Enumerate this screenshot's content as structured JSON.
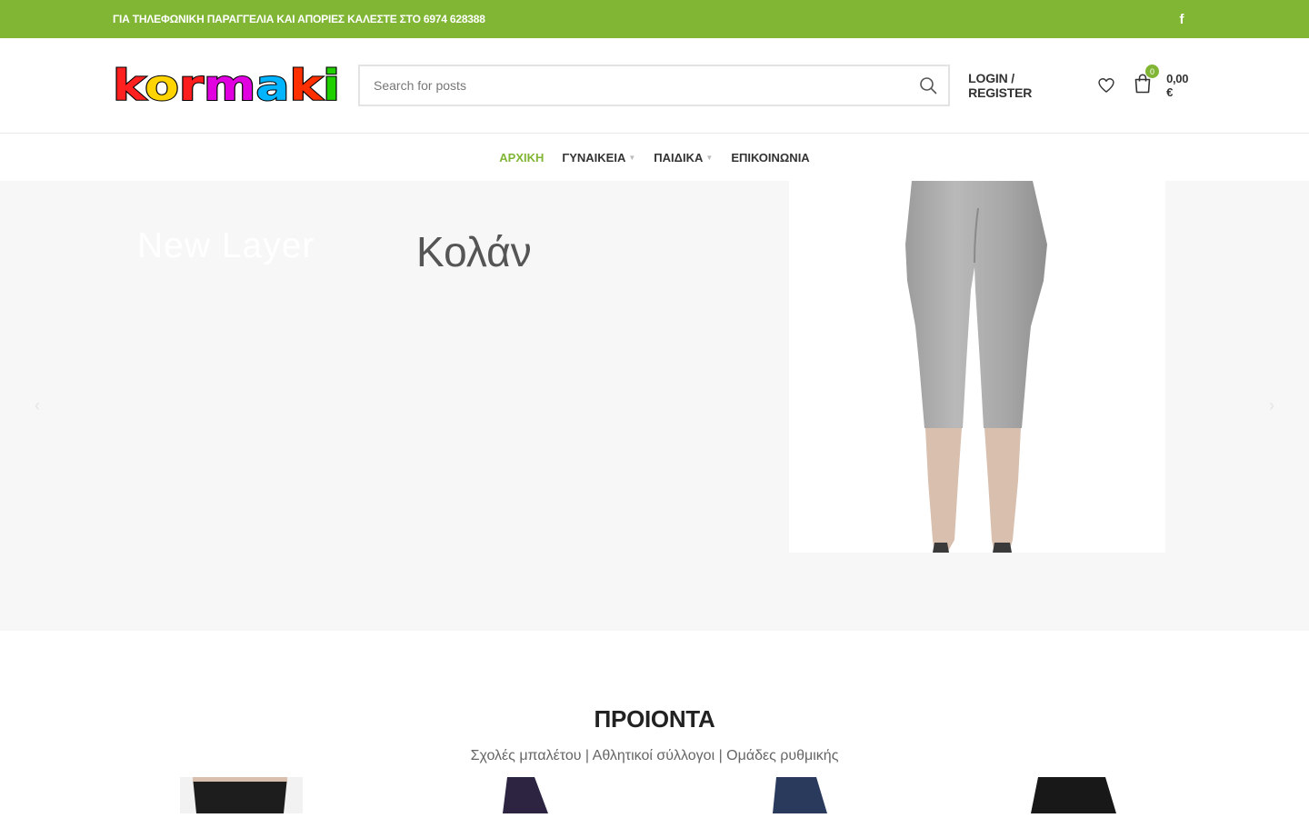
{
  "topbar": {
    "message": "ΓΙΑ ΤΗΛΕΦΩΝΙΚΗ ΠΑΡΑΓΓΕΛΙΑ ΚΑΙ ΑΠΟΡΙΕΣ ΚΑΛΕΣΤΕ ΣΤΟ 6974 628388",
    "social_glyph": "f",
    "bg_color": "#81b635"
  },
  "logo": {
    "text": "kormaki",
    "letter_colors": [
      "#ff2020",
      "#ffd400",
      "#ff1e1e",
      "#e000e0",
      "#00b4ff",
      "#ff3000",
      "#20d000"
    ]
  },
  "search": {
    "placeholder": "Search for posts"
  },
  "header": {
    "login_label": "LOGIN / REGISTER",
    "cart_count": "0",
    "cart_total": "0,00 €"
  },
  "nav": {
    "items": [
      {
        "label": "ΑΡΧΙΚΗ",
        "active": true,
        "dropdown": false
      },
      {
        "label": "ΓΥΝΑΙΚΕΙΑ",
        "active": false,
        "dropdown": true
      },
      {
        "label": "ΠΑΙΔΙΚΑ",
        "active": false,
        "dropdown": true
      },
      {
        "label": "ΕΠΙΚΟΙΝΩΝΙΑ",
        "active": false,
        "dropdown": false
      }
    ],
    "accent_color": "#81b635"
  },
  "hero": {
    "layer_text": "New Layer",
    "title": "Κολάν",
    "prev_glyph": "‹",
    "next_glyph": "›"
  },
  "products": {
    "heading": "ΠΡΟΙΟΝΤΑ",
    "subtitle": "Σχολές μπαλέτου | Αθλητικοί σύλλογοι | Ομάδες ρυθμικής"
  }
}
